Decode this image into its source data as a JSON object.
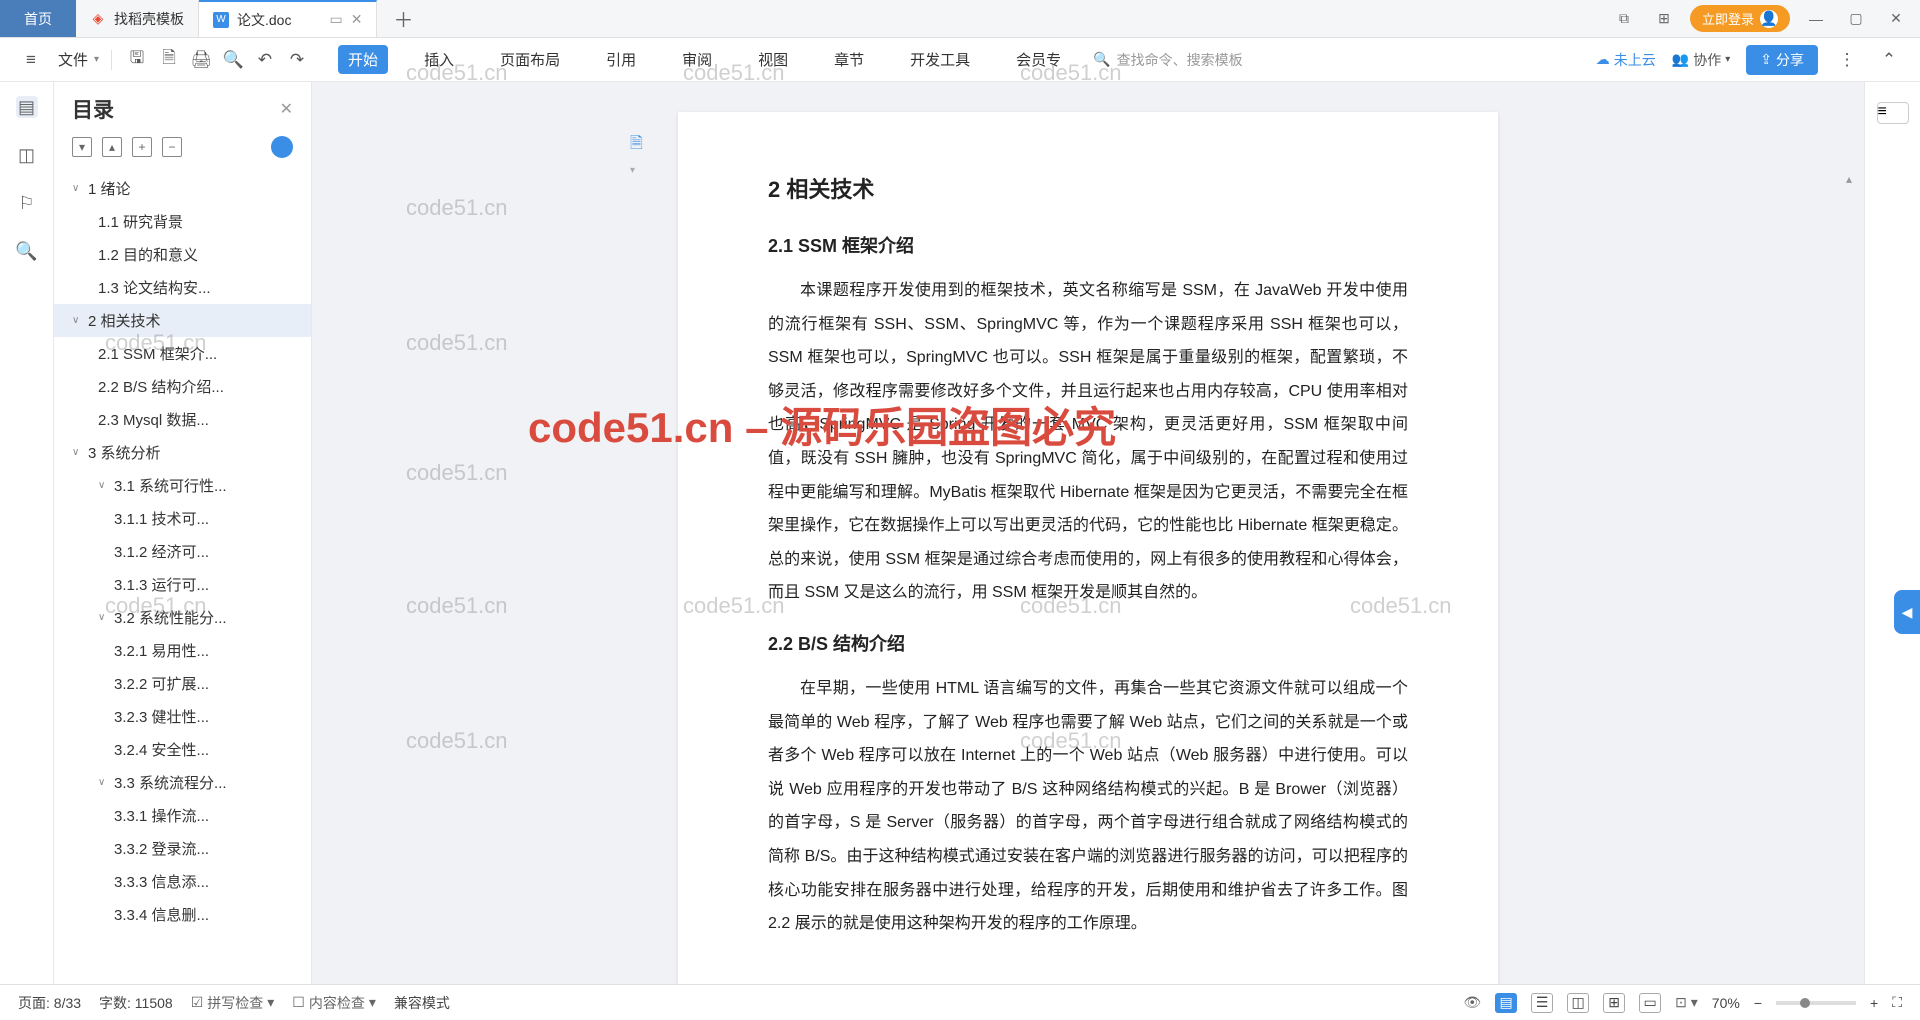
{
  "titlebar": {
    "home": "首页",
    "tab1": "找稻壳模板",
    "tab2": "论文.doc",
    "login": "立即登录"
  },
  "toolbar": {
    "file": "文件",
    "ribbon": [
      "开始",
      "插入",
      "页面布局",
      "引用",
      "审阅",
      "视图",
      "章节",
      "开发工具",
      "会员专"
    ],
    "search_placeholder": "查找命令、搜索模板",
    "cloud": "未上云",
    "collab": "协作",
    "share": "分享"
  },
  "outline": {
    "title": "目录",
    "items": [
      {
        "lvl": 1,
        "text": "1  绪论",
        "chev": "∨"
      },
      {
        "lvl": 2,
        "text": "1.1  研究背景"
      },
      {
        "lvl": 2,
        "text": "1.2  目的和意义"
      },
      {
        "lvl": 2,
        "text": "1.3  论文结构安..."
      },
      {
        "lvl": 1,
        "text": "2  相关技术",
        "chev": "∨",
        "sel": true
      },
      {
        "lvl": 2,
        "text": "2.1  SSM 框架介..."
      },
      {
        "lvl": 2,
        "text": "2.2  B/S 结构介绍..."
      },
      {
        "lvl": 2,
        "text": "2.3  Mysql 数据..."
      },
      {
        "lvl": 1,
        "text": "3  系统分析",
        "chev": "∨"
      },
      {
        "lvl": 2,
        "text": "3.1  系统可行性...",
        "chev": "∨"
      },
      {
        "lvl": 3,
        "text": "3.1.1  技术可..."
      },
      {
        "lvl": 3,
        "text": "3.1.2  经济可..."
      },
      {
        "lvl": 3,
        "text": "3.1.3  运行可..."
      },
      {
        "lvl": 2,
        "text": "3.2  系统性能分...",
        "chev": "∨"
      },
      {
        "lvl": 3,
        "text": "3.2.1  易用性..."
      },
      {
        "lvl": 3,
        "text": "3.2.2  可扩展..."
      },
      {
        "lvl": 3,
        "text": "3.2.3  健壮性..."
      },
      {
        "lvl": 3,
        "text": "3.2.4  安全性..."
      },
      {
        "lvl": 2,
        "text": "3.3  系统流程分...",
        "chev": "∨"
      },
      {
        "lvl": 3,
        "text": "3.3.1  操作流..."
      },
      {
        "lvl": 3,
        "text": "3.3.2  登录流..."
      },
      {
        "lvl": 3,
        "text": "3.3.3  信息添..."
      },
      {
        "lvl": 3,
        "text": "3.3.4  信息删..."
      }
    ]
  },
  "doc": {
    "h2": "2  相关技术",
    "h3a": "2.1 SSM 框架介绍",
    "p1": "本课题程序开发使用到的框架技术，英文名称缩写是 SSM，在 JavaWeb 开发中使用的流行框架有 SSH、SSM、SpringMVC 等，作为一个课题程序采用 SSH 框架也可以，SSM 框架也可以，SpringMVC 也可以。SSH 框架是属于重量级别的框架，配置繁琐，不够灵活，修改程序需要修改好多个文件，并且运行起来也占用内存较高，CPU 使用率相对也高，SpringMVC 是 Spring 开发的一套 MVC 架构，更灵活更好用，SSM 框架取中间值，既没有 SSH 臃肿，也没有 SpringMVC 简化，属于中间级别的，在配置过程和使用过程中更能编写和理解。MyBatis 框架取代 Hibernate 框架是因为它更灵活，不需要完全在框架里操作，它在数据操作上可以写出更灵活的代码，它的性能也比 Hibernate 框架更稳定。总的来说，使用 SSM 框架是通过综合考虑而使用的，网上有很多的使用教程和心得体会，而且 SSM 又是这么的流行，用 SSM 框架开发是顺其自然的。",
    "h3b": "2.2 B/S 结构介绍",
    "p2": "在早期，一些使用 HTML 语言编写的文件，再集合一些其它资源文件就可以组成一个最简单的 Web 程序，了解了 Web 程序也需要了解 Web 站点，它们之间的关系就是一个或者多个 Web 程序可以放在 Internet 上的一个 Web 站点（Web 服务器）中进行使用。可以说 Web 应用程序的开发也带动了 B/S 这种网络结构模式的兴起。B 是 Brower（浏览器）的首字母，S 是 Server（服务器）的首字母，两个首字母进行组合就成了网络结构模式的简称 B/S。由于这种结构模式通过安装在客户端的浏览器进行服务器的访问，可以把程序的核心功能安排在服务器中进行处理，给程序的开发，后期使用和维护省去了许多工作。图 2.2 展示的就是使用这种架构开发的程序的工作原理。"
  },
  "watermarks": {
    "wm": "code51.cn",
    "big": "code51.cn – 源码乐园盗图必究"
  },
  "status": {
    "page": "页面: 8/33",
    "words": "字数: 11508",
    "spell": "拼写检查",
    "content": "内容检查",
    "compat": "兼容模式",
    "zoom": "70%"
  }
}
